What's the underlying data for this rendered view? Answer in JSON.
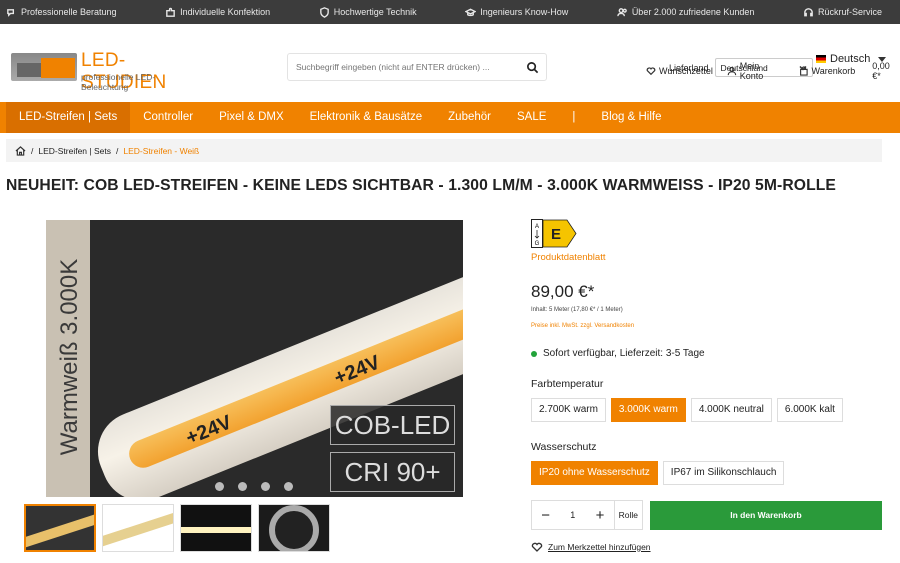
{
  "topbar": {
    "items": [
      {
        "icon": "phone-chat-icon",
        "label": "Professionelle Beratung"
      },
      {
        "icon": "puzzle-icon",
        "label": "Individuelle Konfektion"
      },
      {
        "icon": "shield-icon",
        "label": "Hochwertige Technik"
      },
      {
        "icon": "graduation-cap-icon",
        "label": "Ingenieurs Know-How"
      },
      {
        "icon": "users-icon",
        "label": "Über 2.000 zufriedene Kunden"
      },
      {
        "icon": "headset-icon",
        "label": "Rückruf-Service"
      }
    ]
  },
  "logo": {
    "name": "LED-STUDIEN",
    "tagline": "professionelle LED-Beleuchtung"
  },
  "search": {
    "placeholder": "Suchbegriff eingeben (nicht auf ENTER drücken) ..."
  },
  "shipping": {
    "label": "Lieferland",
    "value": "Deutschland"
  },
  "language": {
    "value": "Deutsch"
  },
  "actions": {
    "wishlist": "Wunschzettel",
    "account": "Mein Konto",
    "cart": "Warenkorb",
    "cart_total": "0,00 €*"
  },
  "nav": [
    "LED-Streifen | Sets",
    "Controller",
    "Pixel & DMX",
    "Elektronik & Bausätze",
    "Zubehör",
    "SALE",
    "|",
    "Blog & Hilfe"
  ],
  "breadcrumb": {
    "parent": "LED-Streifen | Sets",
    "current": "LED-Streifen - Weiß"
  },
  "product": {
    "title": "NEUHEIT: COB LED-STREIFEN - KEINE LEDS SICHTBAR - 1.300 LM/M - 3.000K WARMWEISS - IP20 5M-ROLLE",
    "image": {
      "side_text": "Warmweiß 3.000K",
      "label1": "+24V",
      "label2": "+24V",
      "badge1": "COB-LED",
      "badge2": "CRI 90+"
    },
    "energy": {
      "top": "A",
      "bottom": "G",
      "class": "E"
    },
    "datasheet": "Produktdatenblatt",
    "price": "89,00 €*",
    "content": "Inhalt: 5 Meter (17,80 €* / 1 Meter)",
    "tax_note": "Preise inkl. MwSt. zzgl. Versandkosten",
    "availability": "Sofort verfügbar, Lieferzeit: 3-5 Tage",
    "color_label": "Farbtemperatur",
    "color_options": [
      "2.700K warm",
      "3.000K warm",
      "4.000K neutral",
      "6.000K kalt"
    ],
    "color_selected": "3.000K warm",
    "protection_label": "Wasserschutz",
    "protection_options": [
      "IP20 ohne Wasserschutz",
      "IP67 im Silikonschlauch"
    ],
    "protection_selected": "IP20 ohne Wasserschutz",
    "quantity": "1",
    "unit": "Rolle",
    "add_to_cart": "In den Warenkorb",
    "add_to_wishlist": "Zum Merkzettel hinzufügen"
  },
  "colors": {
    "accent": "#f08200",
    "cart_button": "#2a9a3a",
    "topbar": "#3c3c3c"
  }
}
